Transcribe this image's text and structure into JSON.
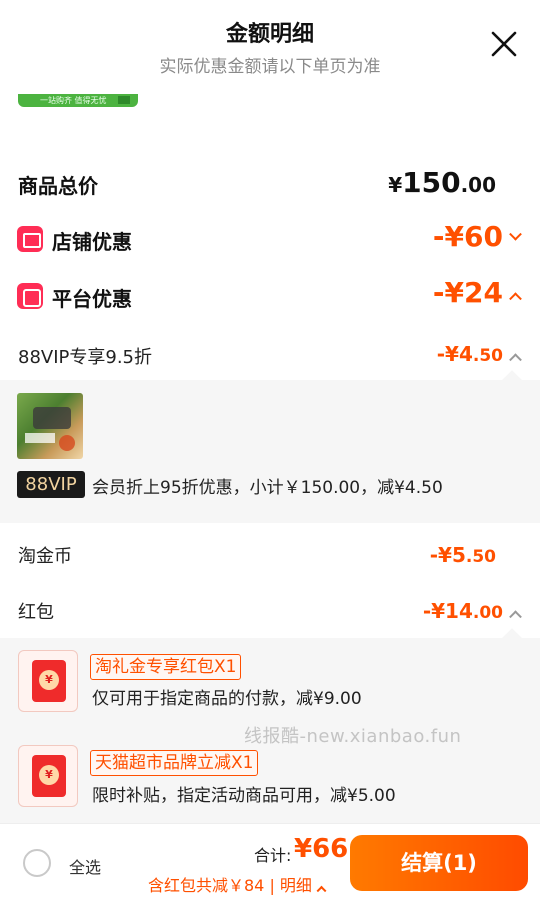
{
  "header": {
    "title": "金额明细",
    "subtitle": "实际优惠金额请以下单页为准"
  },
  "banner_sliver_text": "一站购齐 值得无忧",
  "subtotal": {
    "label": "商品总价",
    "currency": "¥",
    "integer": "150",
    "decimal": ".00"
  },
  "shop_discount": {
    "label": "店铺优惠",
    "amount": "-¥60",
    "expanded": false
  },
  "platform_discount": {
    "label": "平台优惠",
    "amount": "-¥24",
    "expanded": true
  },
  "vip_discount": {
    "label": "88VIP专享9.5折",
    "amount_main": "-¥4",
    "amount_dec": ".50",
    "expanded": true,
    "badge": "88VIP",
    "detail": "会员折上95折优惠，小计￥150.00，减¥4.50"
  },
  "coins": {
    "label": "淘金币",
    "amount_main": "-¥5",
    "amount_dec": ".50"
  },
  "red_packet": {
    "label": "红包",
    "amount_main": "-¥14",
    "amount_dec": ".00",
    "expanded": true,
    "items": [
      {
        "tag": "淘礼金专享红包X1",
        "desc": "仅可用于指定商品的付款，减¥9.00"
      },
      {
        "tag": "天猫超市品牌立减X1",
        "desc": "限时补贴，指定活动商品可用，减¥5.00"
      }
    ]
  },
  "watermark": "线报酷-new.xianbao.fun",
  "bottom_bar": {
    "select_all": "全选",
    "total_label": "合计:",
    "total_amount": "¥66",
    "savings_note": "含红包共减￥84 | 明细",
    "checkout_label": "结算(1)"
  },
  "colors": {
    "accent": "#ff5000",
    "icon_red": "#ff2d55",
    "panel_bg": "#f6f6f6"
  },
  "icons": [
    "close-icon",
    "shop-icon",
    "platform-icon",
    "chevron-down-icon",
    "chevron-up-icon",
    "red-packet-icon",
    "radio-icon"
  ]
}
